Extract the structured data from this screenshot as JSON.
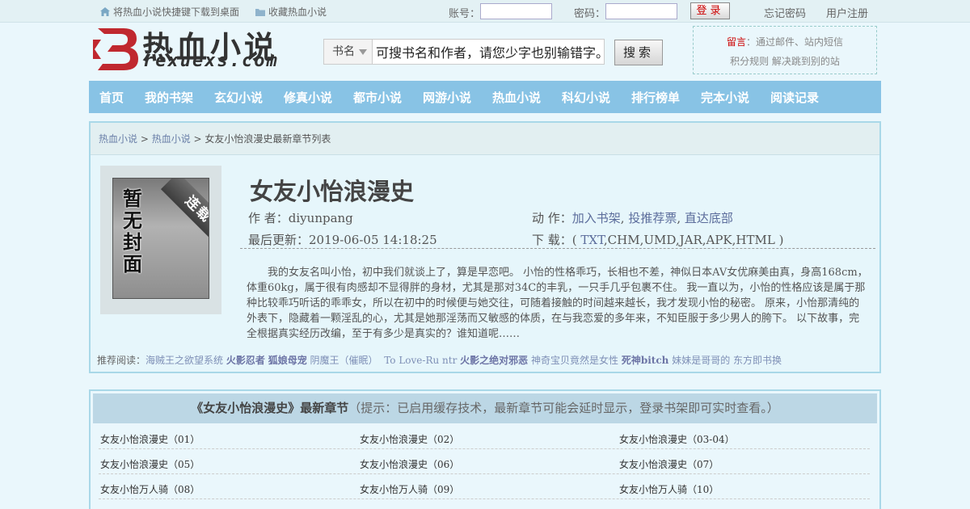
{
  "topbar": {
    "bookmark_shortcut": "将热血小说快捷键下载到桌面",
    "favorite": "收藏热血小说",
    "account_label": "账号：",
    "password_label": "密码：",
    "account_value": "",
    "password_value": "",
    "login_button": "登录",
    "forgot_password": "忘记密码",
    "register": "用户注册"
  },
  "logo": {
    "cn": "热血小说",
    "en": "rexuexs.com",
    "brand_color": "#c0282f"
  },
  "search": {
    "select_value": "书名",
    "input_value": "可搜书名和作者，请您少字也别输错字。",
    "button": "搜索"
  },
  "notice": {
    "label": "留言",
    "line1": "：通过邮件、站内短信",
    "line2": "积分规则  解决跳到别的站"
  },
  "nav": {
    "items": [
      "首页",
      "我的书架",
      "玄幻小说",
      "修真小说",
      "都市小说",
      "网游小说",
      "热血小说",
      "科幻小说",
      "排行榜单",
      "完本小说",
      "阅读记录"
    ]
  },
  "breadcrumb": {
    "home": "热血小说",
    "sep1": " > ",
    "category": "热血小说",
    "sep2": " > ",
    "current": "女友小怡浪漫史最新章节列表"
  },
  "cover": {
    "placeholder": "暂无封面",
    "ribbon": "连载中"
  },
  "book": {
    "title": "女友小怡浪漫史",
    "author_label": "作    者：",
    "author": "diyunpang",
    "updated_label": "最后更新：",
    "updated": "2019-06-05 14:18:25",
    "action_label": "动    作：",
    "action_shelf": "加入书架",
    "action_sep1": ", ",
    "action_vote": "投推荐票",
    "action_sep2": ", ",
    "action_bottom": "直达底部",
    "download_label": "下    载：",
    "download_open": "( ",
    "download_txt": "TXT",
    "download_rest": ",CHM,UMD,JAR,APK,HTML )",
    "intro": "我的女友名叫小怡，初中我们就谈上了，算是早恋吧。 小怡的性格乖巧，长相也不差，神似日本AV女优麻美由真，身高168cm，体重60kg，属于很有肉感却不显得胖的身材，尤其是那对34C的丰乳，一只手几乎包裹不住。 我一直以为，小怡的性格应该是属于那种比较乖巧听话的乖乖女，所以在初中的时候便与她交往，可随着接触的时间越来越长，我才发现小怡的秘密。 原来，小怡那清纯的外表下，隐藏着一颗淫乱的心，尤其是她那淫荡而又敏感的体质，在与我恋爱的多年来，不知臣服于多少男人的胯下。 以下故事，完全根据真实经历改编，至于有多少是真实的？谁知道呢……"
  },
  "recommend": {
    "label": "推荐阅读：",
    "items": [
      {
        "text": "海贼王之欲望系统",
        "bold": false
      },
      {
        "text": "火影忍者",
        "bold": true
      },
      {
        "text": "狐娘母宠",
        "bold": true
      },
      {
        "text": "阴魔王（催眠）",
        "bold": false
      },
      {
        "text": "To Love-Ru ntr",
        "bold": false
      },
      {
        "text": "火影之绝对邪恶",
        "bold": true
      },
      {
        "text": "神奇宝贝竟然是女性",
        "bold": false
      },
      {
        "text": "死神bitch",
        "bold": true
      },
      {
        "text": "妹妹是哥哥的",
        "bold": false
      },
      {
        "text": "东方即书换",
        "bold": false
      }
    ]
  },
  "chapters": {
    "head_title": "《女友小怡浪漫史》最新章节",
    "head_hint": "（提示：已启用缓存技术，最新章节可能会延时显示，登录书架即可实时查看。）",
    "rows": [
      [
        "女友小怡浪漫史（01）",
        "女友小怡浪漫史（02）",
        "女友小怡浪漫史（03-04）"
      ],
      [
        "女友小怡浪漫史（05）",
        "女友小怡浪漫史（06）",
        "女友小怡浪漫史（07）"
      ],
      [
        "女友小怡万人骑（08）",
        "女友小怡万人骑（09）",
        "女友小怡万人骑（10）"
      ]
    ]
  }
}
